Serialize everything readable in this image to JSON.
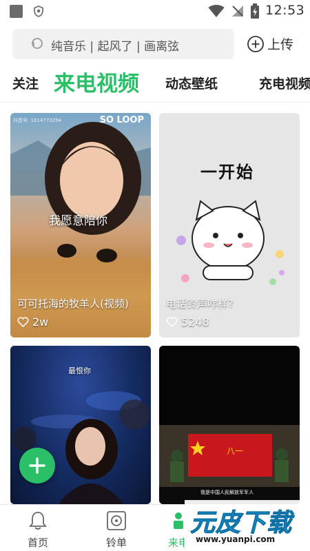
{
  "status_bar": {
    "time": "12:53",
    "icons": [
      "app-notification-icon",
      "shield-icon",
      "wifi-icon",
      "signal-icon",
      "battery-charging-icon"
    ]
  },
  "search": {
    "placeholder": "纯音乐 | 起风了 | 画离弦",
    "icon": "search-icon"
  },
  "upload": {
    "label": "上传",
    "icon": "plus-circle-icon"
  },
  "tabs": [
    {
      "label": "关注",
      "active": false
    },
    {
      "label": "来电视频",
      "active": true
    },
    {
      "label": "动态壁纸",
      "active": false
    },
    {
      "label": "充电视频",
      "active": false
    }
  ],
  "cards": [
    {
      "title": "可可托海的牧羊人(视频)",
      "likes": "2w",
      "caption": "我愿意陪你",
      "badge": "SO LOOP",
      "watermark": "抖音号: 1814773294"
    },
    {
      "title": "电话铃声咋样?",
      "likes": "5248",
      "caption": "一开始"
    },
    {
      "caption": "最恨你"
    },
    {
      "caption": "我是中国人民解放军军人",
      "flag_text": "八一"
    }
  ],
  "fab": {
    "icon": "plus-icon"
  },
  "bottom_nav": [
    {
      "label": "首页",
      "icon": "bell-icon",
      "active": false
    },
    {
      "label": "铃单",
      "icon": "music-box-icon",
      "active": false
    },
    {
      "label": "来电",
      "icon": "phone-video-icon",
      "active": true
    }
  ],
  "watermark": {
    "main": "元皮下载",
    "url": "www.yuanpi.com"
  },
  "colors": {
    "accent": "#2bbf68",
    "search_bg": "#f1f1f1",
    "watermark_blue": "#26a9e0"
  }
}
